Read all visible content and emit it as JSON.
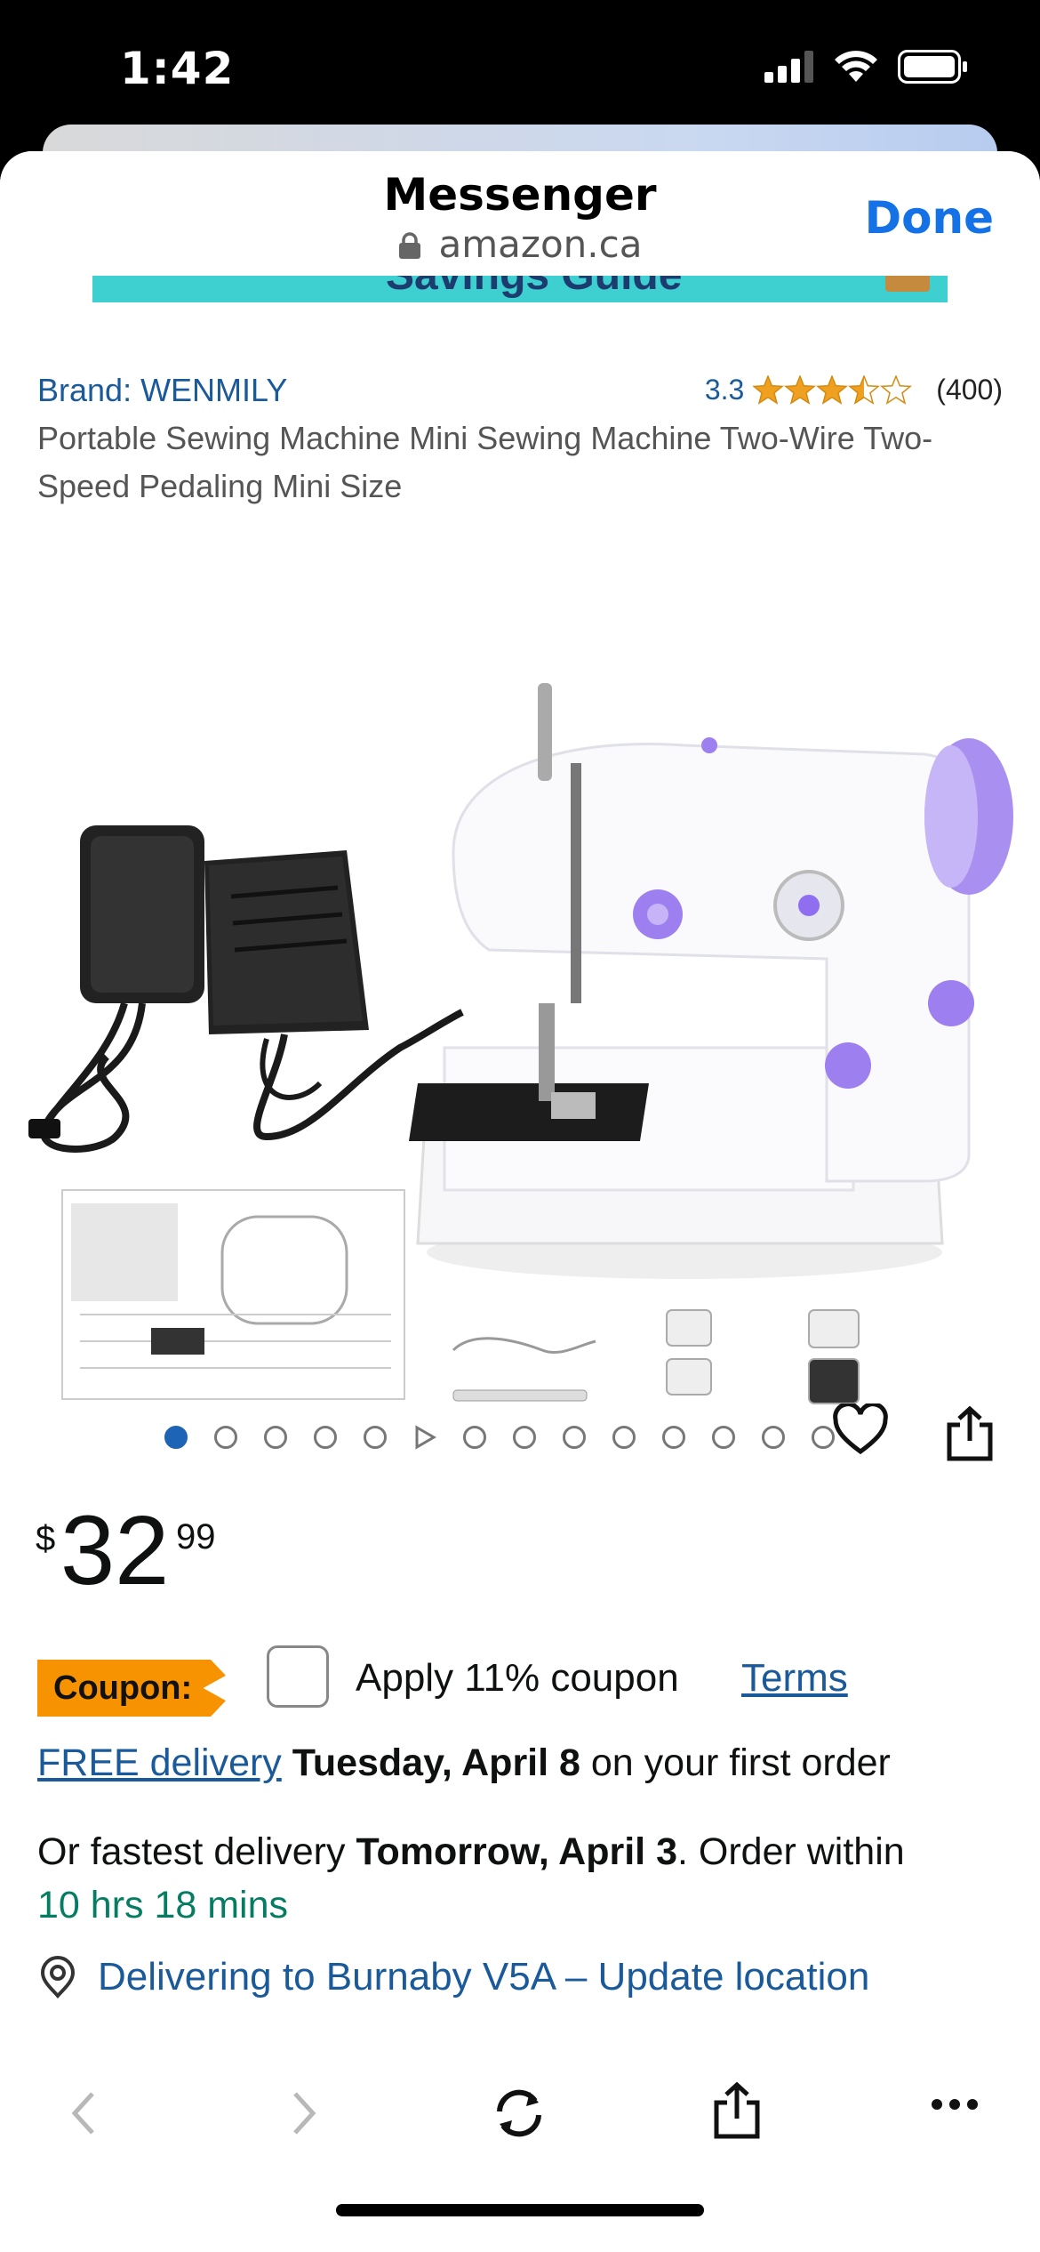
{
  "status": {
    "time": "1:42"
  },
  "header": {
    "title": "Messenger",
    "url": "amazon.ca",
    "done_label": "Done"
  },
  "banner": {
    "text": "Savings Guide"
  },
  "product": {
    "brand": "Brand: WENMILY",
    "rating": "3.3",
    "stars": 3.5,
    "review_count": "(400)",
    "title": "Portable Sewing Machine Mini Sewing Machine Two-Wire Two-Speed Pedaling Mini Size",
    "image_count": 14,
    "active_image": 1,
    "video_dot_index": 6
  },
  "price": {
    "currency": "$",
    "whole": "32",
    "cents": "99"
  },
  "coupon": {
    "tag": "Coupon:",
    "text": "Apply 11% coupon",
    "terms": "Terms"
  },
  "delivery": {
    "link": "FREE delivery",
    "date": "Tuesday, April 8",
    "suffix": "on your first order",
    "fastest_prefix": "Or fastest delivery",
    "fastest_date": "Tomorrow, April 3",
    "fastest_mid": ". Order within",
    "countdown": "10 hrs 18 mins"
  },
  "location": {
    "text": "Delivering to Burnaby V5A – Update location"
  },
  "colors": {
    "link": "#1a5a9a",
    "accent": "#1472e6",
    "coupon": "#f79300",
    "star": "#f0a020",
    "green": "#067d62"
  }
}
